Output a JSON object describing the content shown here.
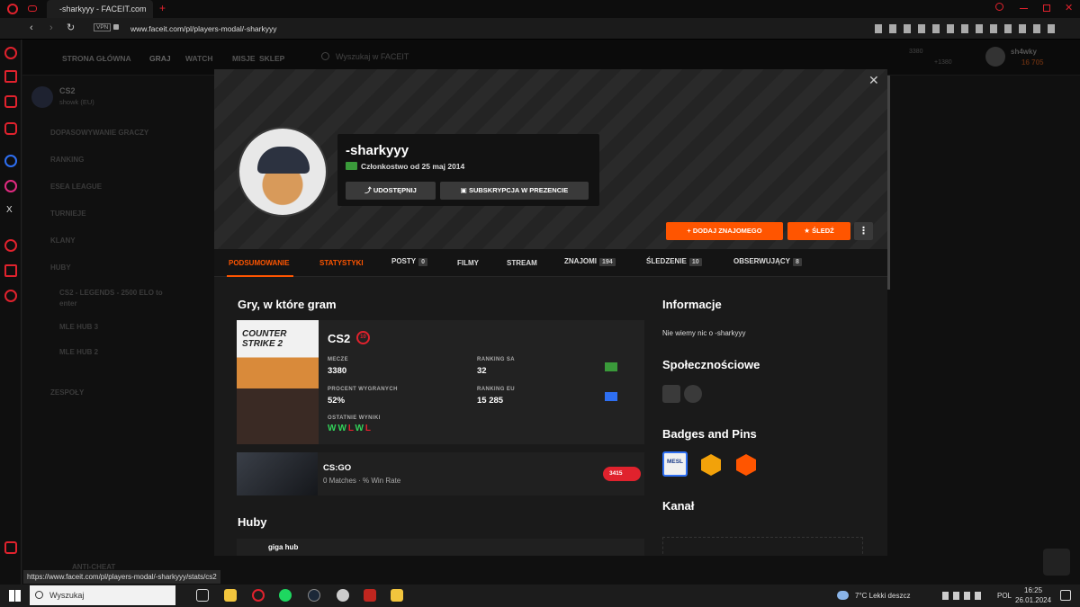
{
  "browser": {
    "tab_title": "-sharkyyy - FACEIT.com",
    "url": "www.faceit.com/pl/players-modal/-sharkyyy",
    "vpn_label": "VPN",
    "status_url": "https://www.faceit.com/pl/players-modal/-sharkyyy/stats/cs2"
  },
  "faceit_nav": {
    "items": [
      "STRONA GŁÓWNA",
      "GRAJ",
      "WATCH",
      "MISJE",
      "SKLEP"
    ],
    "search_placeholder": "Wyszukaj w FACEIT",
    "user_name": "sh4wky",
    "points": "16 705",
    "elo_current": "3380",
    "elo_diff": "+1380"
  },
  "faceit_sidebar": {
    "game": "CS2",
    "region": "showk (EU)",
    "items": [
      "DOPASOWYWANIE GRACZY",
      "RANKING",
      "ESEA LEAGUE",
      "TURNIEJE",
      "KLANY",
      "HUBY",
      "CS2 - LEGENDS - 2500 ELO to enter",
      "MLE HUB 3",
      "MLE HUB 2",
      "ZESPOŁY",
      "ANTI-CHEAT"
    ]
  },
  "profile": {
    "username": "-sharkyyy",
    "membership": "Członkostwo od 25 maj 2014",
    "share_label": "UDOSTĘPNIJ",
    "gift_label": "SUBSKRYPCJA W PREZENCIE",
    "add_friend_label": "DODAJ ZNAJOMEGO",
    "follow_label": "ŚLEDŹ"
  },
  "tabs": [
    {
      "label": "PODSUMOWANIE",
      "count": ""
    },
    {
      "label": "STATYSTYKI",
      "count": ""
    },
    {
      "label": "POSTY",
      "count": "0"
    },
    {
      "label": "FILMY",
      "count": ""
    },
    {
      "label": "STREAM",
      "count": ""
    },
    {
      "label": "ZNAJOMI",
      "count": "194"
    },
    {
      "label": "ŚLEDZENIE",
      "count": "10"
    },
    {
      "label": "OBSERWUJĄCY",
      "count": "8"
    }
  ],
  "games_section": {
    "title": "Gry, w które gram",
    "cs2": {
      "name": "CS2",
      "level": "10",
      "cover_text": "COUNTER STRIKE 2",
      "matches_label": "MECZE",
      "matches": "3380",
      "ranking_sa_label": "RANKING SA",
      "ranking_sa": "32",
      "winrate_label": "PROCENT WYGRANYCH",
      "winrate": "52%",
      "ranking_eu_label": "RANKING EU",
      "ranking_eu": "15 285",
      "recent_label": "OSTATNIE WYNIKI",
      "recent": [
        "W",
        "W",
        "L",
        "W",
        "L"
      ]
    },
    "csgo": {
      "name": "CS:GO",
      "sub": "0 Matches · % Win Rate",
      "elo": "3415"
    }
  },
  "hubs_section": {
    "title": "Huby",
    "hub_name": "giga hub"
  },
  "info": {
    "title": "Informacje",
    "text": "Nie wiemy nic o -sharkyyy",
    "social_title": "Społecznościowe",
    "badges_title": "Badges and Pins",
    "badge_text": "MESL",
    "channel_title": "Kanał"
  },
  "taskbar": {
    "search_placeholder": "Wyszukaj",
    "weather": "7°C  Lekki deszcz",
    "lang": "POL",
    "time": "16:25",
    "date": "26.01.2024"
  },
  "colors": {
    "accent": "#ff5500",
    "win": "#32d35a",
    "loss": "#e0222d"
  }
}
